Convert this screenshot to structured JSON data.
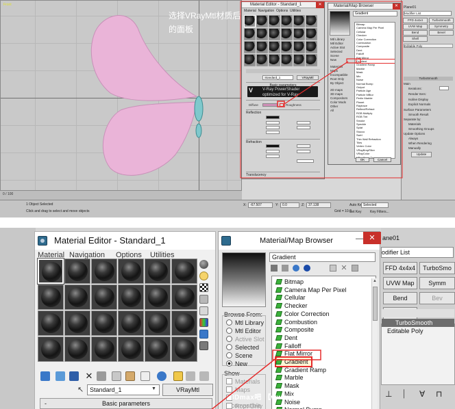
{
  "top": {
    "annotation": "选择VRayMtl材质后的面板",
    "viewport_corner": "Front",
    "status_line1": "1 Object Selected",
    "status_line2": "Click and drag to select and move objects",
    "timeline_left": "0 / 100",
    "coords": {
      "x": "-67.507",
      "y": "0.0",
      "z": "37.138"
    },
    "grid_text": "Grid = 10.0",
    "auto_key": "Auto Key",
    "set_key": "Set Key",
    "key_filters": "Key Filters...",
    "selected": "Selected",
    "material_editor_title": "Material Editor - Standard_1",
    "material_editor_menu": [
      "Material",
      "Navigation",
      "Options",
      "Utilities"
    ],
    "mat_name": "Standard_1",
    "mat_type": "VRayMtl",
    "basic_parameters": "Basic parameters",
    "vray_logo": "V-Ray PowerShader",
    "vray_sub": "optimized for V-Ray",
    "diffuse": "Diffuse",
    "roughness": "Roughness",
    "reflection": "Reflection",
    "refraction": "Refraction",
    "translucency": "Translucency",
    "browser_title": "Material/Map Browser",
    "browser_gradient": "Gradient",
    "browse_from": [
      "Mtl Library",
      "Mtl Editor",
      "Active Slot",
      "Selected",
      "Scene",
      "New"
    ],
    "show": [
      "Materials",
      "Maps",
      "Incompatible",
      "Root Only",
      "By Object"
    ],
    "show2": [
      "2D maps",
      "3D maps",
      "Compositors",
      "Color Mods",
      "Other",
      "All"
    ],
    "map_list": [
      "Bitmap",
      "Camera Map Per Pixel",
      "Cellular",
      "Checker",
      "Color Correction",
      "Combustion",
      "Composite",
      "Dent",
      "Falloff",
      "Flat Mirror",
      "Gradient",
      "Gradient Ramp",
      "Marble",
      "Mask",
      "Mix",
      "Noise",
      "Normal Bump",
      "Output",
      "Particle Age",
      "Particle MBlur",
      "Perlin Marble",
      "Planet",
      "Raytrace",
      "Reflect/Refract",
      "RGB Multiply",
      "RGB Tint",
      "Smoke",
      "Speckle",
      "Splat",
      "Stucco",
      "Swirl",
      "Thin Wall Refraction",
      "Tiles",
      "Vertex Color",
      "VRayBmpFilter",
      "VRayColor",
      "VRayCompTex",
      "VRayDirt",
      "VRayEdgesTex"
    ],
    "ok": "OK",
    "cancel": "Cancel",
    "cmd_items": [
      "Plane01",
      "Modifier List",
      "FFD 4x4x4",
      "TurboSmooth",
      "UVW Map",
      "Symmetry",
      "Bend",
      "Bevel",
      "Shell",
      "Editable Poly",
      "TurboSmooth",
      "Main",
      "Iterations:",
      "Render Iters:",
      "Isoline Display",
      "Explicit Normals",
      "Surface Parameters",
      "Smooth Result",
      "Separate by:",
      "Materials",
      "Smoothing Groups",
      "Update Options",
      "Always",
      "When Rendering",
      "Manually",
      "Update"
    ]
  },
  "bottom": {
    "material_editor": {
      "title": "Material Editor - Standard_1",
      "menu": [
        "Material",
        "Navigation",
        "Options",
        "Utilities"
      ],
      "material_name": "Standard_1",
      "material_type": "VRayMtl",
      "rollout": "Basic parameters",
      "rollout_toggle": "-"
    },
    "browser": {
      "title": "Material/Map Browser",
      "name_field": "Gradient",
      "browse_from_label": "Browse From:",
      "browse_from": [
        "Mtl Library",
        "Mtl Editor",
        "Active Slot",
        "Selected",
        "Scene",
        "New"
      ],
      "browse_from_selected": "New",
      "show_label": "Show",
      "show": [
        "Materials",
        "Maps",
        "Incompatible",
        "Root Only"
      ],
      "maps": [
        "Bitmap",
        "Camera Map Per Pixel",
        "Cellular",
        "Checker",
        "Color Correction",
        "Combustion",
        "Composite",
        "Dent",
        "Falloff",
        "Flat Mirror",
        "Gradient",
        "Gradient Ramp",
        "Marble",
        "Mask",
        "Mix",
        "Noise",
        "Normal Bump"
      ],
      "highlighted": "Gradient",
      "minimize": "—",
      "close": "✕"
    },
    "command_panel": {
      "object_name": "ane01",
      "modifier_list": "odifier List",
      "buttons": [
        "FFD 4x4x4",
        "TurboSmo",
        "UVW Map",
        "Symm",
        "Bend",
        "Bev",
        "Shell"
      ],
      "stack": [
        "TurboSmooth",
        "Editable Poly"
      ]
    },
    "watermark": "3Dmax吧 【www.lineeg.com/tieba/1771】"
  },
  "colors": {
    "highlight_red": "#e52b2b",
    "petal_pink": "#eab4d8",
    "map_icon_green": "#3bb23b",
    "title_close_red": "#c8302a"
  }
}
